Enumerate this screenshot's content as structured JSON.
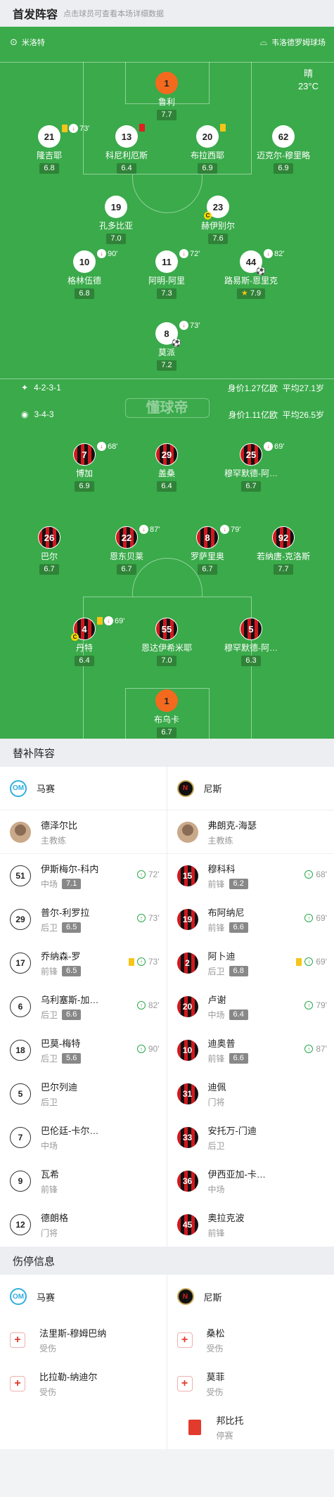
{
  "header": {
    "title": "首发阵容",
    "subtitle": "点击球员可查看本场详细数据"
  },
  "pitch": {
    "referee": "米洛特",
    "stadium": "韦洛德罗姆球场",
    "weather": "晴",
    "temperature": "23°C",
    "home_formation": "4-2-3-1",
    "home_value": "身价1.27亿欧",
    "home_age": "平均27.1岁",
    "away_formation": "3-4-3",
    "away_value": "身价1.11亿欧",
    "away_age": "平均26.5岁",
    "watermark": "懂球帝"
  },
  "home_players": [
    {
      "num": "1",
      "name": "鲁利",
      "rating": "7.7",
      "kit": "o"
    },
    {
      "num": "21",
      "name": "隆吉耶",
      "rating": "6.8",
      "kit": "w",
      "yellow": true,
      "sub": true,
      "min": "73'"
    },
    {
      "num": "13",
      "name": "科尼利厄斯",
      "rating": "6.4",
      "kit": "w",
      "red": true
    },
    {
      "num": "20",
      "name": "布拉西耶",
      "rating": "6.9",
      "kit": "w",
      "yellow": true
    },
    {
      "num": "62",
      "name": "迈克尔-穆里略",
      "rating": "6.9",
      "kit": "w"
    },
    {
      "num": "19",
      "name": "孔多比亚",
      "rating": "7.0",
      "kit": "w"
    },
    {
      "num": "23",
      "name": "赫伊别尔",
      "rating": "7.6",
      "kit": "w",
      "captain": true
    },
    {
      "num": "10",
      "name": "格林伍德",
      "rating": "6.8",
      "kit": "w",
      "sub": true,
      "min": "90'"
    },
    {
      "num": "11",
      "name": "阿明-阿里",
      "rating": "7.3",
      "kit": "w",
      "sub": true,
      "min": "72'"
    },
    {
      "num": "44",
      "name": "路易斯-恩里克",
      "rating": "7.9",
      "kit": "w",
      "sub": true,
      "min": "82'",
      "star": true,
      "ball": true
    },
    {
      "num": "8",
      "name": "莫派",
      "rating": "7.2",
      "kit": "w",
      "sub": true,
      "min": "73'",
      "ball": true
    }
  ],
  "away_players": [
    {
      "num": "7",
      "name": "博加",
      "rating": "6.9",
      "kit": "s",
      "sub": true,
      "min": "68'"
    },
    {
      "num": "29",
      "name": "盖桑",
      "rating": "6.4",
      "kit": "s"
    },
    {
      "num": "25",
      "name": "穆罕默德-阿…",
      "rating": "6.7",
      "kit": "s",
      "sub": true,
      "min": "69'"
    },
    {
      "num": "26",
      "name": "巴尔",
      "rating": "6.7",
      "kit": "s"
    },
    {
      "num": "22",
      "name": "恩东贝莱",
      "rating": "6.7",
      "kit": "s",
      "sub": true,
      "min": "87'"
    },
    {
      "num": "8",
      "name": "罗萨里奥",
      "rating": "6.7",
      "kit": "s",
      "sub": true,
      "min": "79'"
    },
    {
      "num": "92",
      "name": "若纳唐-克洛斯",
      "rating": "7.7",
      "kit": "s"
    },
    {
      "num": "4",
      "name": "丹特",
      "rating": "6.4",
      "kit": "s",
      "yellow": true,
      "sub": true,
      "min": "69'",
      "captain": true
    },
    {
      "num": "55",
      "name": "恩达伊希米耶",
      "rating": "7.0",
      "kit": "s"
    },
    {
      "num": "5",
      "name": "穆罕默德-阿…",
      "rating": "6.3",
      "kit": "s"
    },
    {
      "num": "1",
      "name": "布乌卡",
      "rating": "6.7",
      "kit": "o"
    }
  ],
  "subs": {
    "title": "替补阵容",
    "home_team": "马赛",
    "away_team": "尼斯",
    "home_coach": {
      "name": "德泽尔比",
      "role": "主教练"
    },
    "away_coach": {
      "name": "弗朗克-海瑟",
      "role": "主教练"
    },
    "home": [
      {
        "num": "51",
        "name": "伊斯梅尔-科内",
        "pos": "中场",
        "rating": "7.1",
        "min": "72'"
      },
      {
        "num": "29",
        "name": "普尔-利罗拉",
        "pos": "后卫",
        "rating": "6.5",
        "min": "73'"
      },
      {
        "num": "17",
        "name": "乔纳森-罗",
        "pos": "前锋",
        "rating": "6.5",
        "min": "73'",
        "yellow": true
      },
      {
        "num": "6",
        "name": "乌利塞斯-加…",
        "pos": "后卫",
        "rating": "6.6",
        "min": "82'"
      },
      {
        "num": "18",
        "name": "巴莫-梅特",
        "pos": "后卫",
        "rating": "5.6",
        "min": "90'"
      },
      {
        "num": "5",
        "name": "巴尔列迪",
        "pos": "后卫"
      },
      {
        "num": "7",
        "name": "巴伦廷-卡尔…",
        "pos": "中场"
      },
      {
        "num": "9",
        "name": "瓦希",
        "pos": "前锋"
      },
      {
        "num": "12",
        "name": "德朗格",
        "pos": "门将"
      }
    ],
    "away": [
      {
        "num": "15",
        "name": "穆科科",
        "pos": "前锋",
        "rating": "6.2",
        "min": "68'"
      },
      {
        "num": "19",
        "name": "布阿纳尼",
        "pos": "前锋",
        "rating": "6.6",
        "min": "69'"
      },
      {
        "num": "2",
        "name": "阿卜迪",
        "pos": "后卫",
        "rating": "6.8",
        "min": "69'",
        "yellow": true
      },
      {
        "num": "20",
        "name": "卢谢",
        "pos": "中场",
        "rating": "6.4",
        "min": "79'"
      },
      {
        "num": "10",
        "name": "迪奥普",
        "pos": "前锋",
        "rating": "6.6",
        "min": "87'"
      },
      {
        "num": "31",
        "name": "迪佩",
        "pos": "门将"
      },
      {
        "num": "33",
        "name": "安托万-门迪",
        "pos": "后卫"
      },
      {
        "num": "36",
        "name": "伊西亚加-卡…",
        "pos": "中场"
      },
      {
        "num": "45",
        "name": "奥拉克波",
        "pos": "前锋"
      }
    ]
  },
  "injuries": {
    "title": "伤停信息",
    "home_team": "马赛",
    "away_team": "尼斯",
    "home": [
      {
        "name": "法里斯-穆姆巴纳",
        "status": "受伤"
      },
      {
        "name": "比拉勒-纳迪尔",
        "status": "受伤"
      }
    ],
    "away": [
      {
        "name": "桑松",
        "status": "受伤",
        "type": "injury"
      },
      {
        "name": "莫菲",
        "status": "受伤",
        "type": "injury"
      },
      {
        "name": "邦比托",
        "status": "停赛",
        "type": "suspension"
      }
    ]
  }
}
